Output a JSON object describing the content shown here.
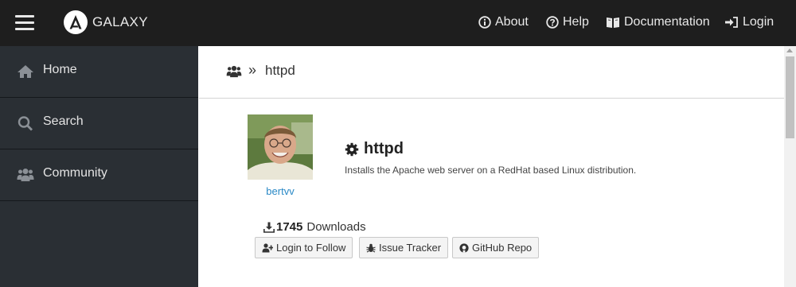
{
  "header": {
    "brand": "GALAXY",
    "nav": [
      {
        "label": "About",
        "icon": "info-icon"
      },
      {
        "label": "Help",
        "icon": "question-icon"
      },
      {
        "label": "Documentation",
        "icon": "book-icon"
      },
      {
        "label": "Login",
        "icon": "sign-in-icon"
      }
    ]
  },
  "sidebar": {
    "items": [
      {
        "label": "Home",
        "icon": "home-icon"
      },
      {
        "label": "Search",
        "icon": "search-icon"
      },
      {
        "label": "Community",
        "icon": "users-icon"
      }
    ]
  },
  "breadcrumb": {
    "separator": "»",
    "current": "httpd"
  },
  "role": {
    "name": "httpd",
    "description": "Installs the Apache web server on a RedHat based Linux distribution.",
    "author": "bertvv",
    "downloads_count": "1745",
    "downloads_label": "Downloads"
  },
  "buttons": {
    "follow": "Login to Follow",
    "issues": "Issue Tracker",
    "github": "GitHub Repo"
  },
  "colors": {
    "topbar": "#1e1e1e",
    "sidebar": "#2a2f34",
    "link": "#2a89c6"
  }
}
